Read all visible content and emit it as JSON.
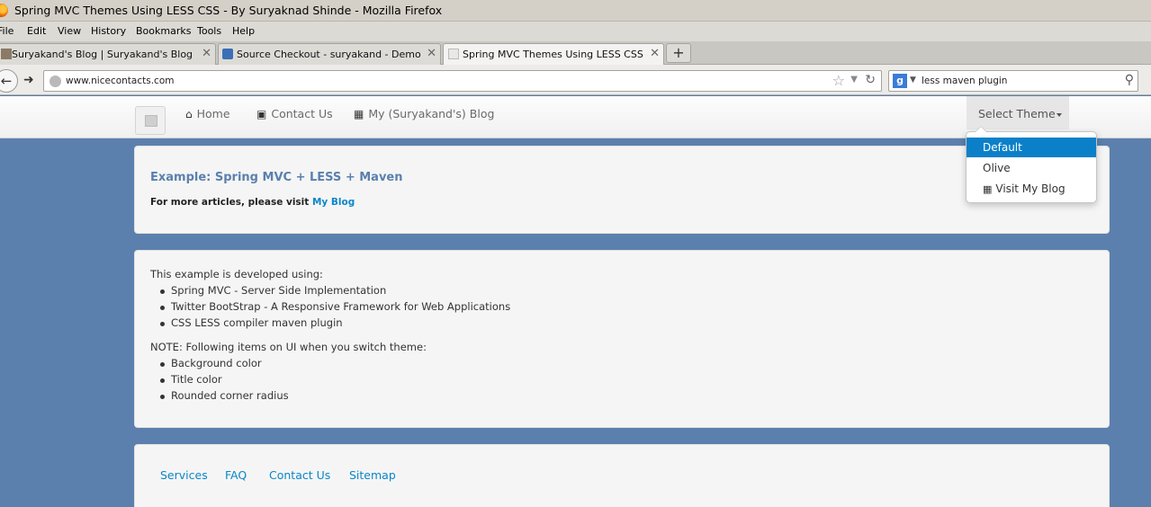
{
  "window": {
    "title": "Spring MVC Themes Using LESS CSS - By Suryaknad Shinde - Mozilla Firefox"
  },
  "menu": [
    "File",
    "Edit",
    "View",
    "History",
    "Bookmarks",
    "Tools",
    "Help"
  ],
  "tabs": [
    {
      "label": "Suryakand's Blog | Suryakand's Blog",
      "close": "✕"
    },
    {
      "label": "Source Checkout - suryakand - Demo Ex...",
      "close": "✕"
    },
    {
      "label": "Spring MVC Themes Using LESS CSS - By ...",
      "close": "✕"
    }
  ],
  "new_tab": "+",
  "address": {
    "url": "www.nicecontacts.com"
  },
  "search": {
    "engine_glyph": "g",
    "query": "less maven plugin"
  },
  "site_nav": {
    "links": [
      {
        "label": "Home",
        "icon": "home-icon"
      },
      {
        "label": "Contact Us",
        "icon": "book-icon"
      },
      {
        "label": "My (Suryakand's) Blog",
        "icon": "grid-icon"
      }
    ],
    "theme_button": "Select Theme"
  },
  "theme_menu": {
    "items": [
      {
        "label": "Default",
        "active": true
      },
      {
        "label": "Olive"
      },
      {
        "label": "Visit My Blog",
        "icon": "grid-icon"
      }
    ],
    "active_color": "#0b80c8"
  },
  "hero": {
    "title": "Example: Spring MVC + LESS + Maven",
    "more_prefix": "For more articles, please visit",
    "more_link": "My Blog"
  },
  "details": {
    "intro": "This example is developed using:",
    "tech": [
      "Spring MVC - Server Side Implementation",
      "Twitter BootStrap - A Responsive Framework for Web Applications",
      "CSS LESS compiler maven plugin"
    ],
    "note": "NOTE: Following items on UI when you switch theme:",
    "items": [
      "Background color",
      "Title color",
      "Rounded corner radius"
    ]
  },
  "footer": {
    "links": [
      "Services",
      "FAQ",
      "Contact Us",
      "Sitemap"
    ]
  },
  "colors": {
    "page_bg": "#5b80ad",
    "title": "#5b80ad",
    "link": "#0b86c9"
  }
}
